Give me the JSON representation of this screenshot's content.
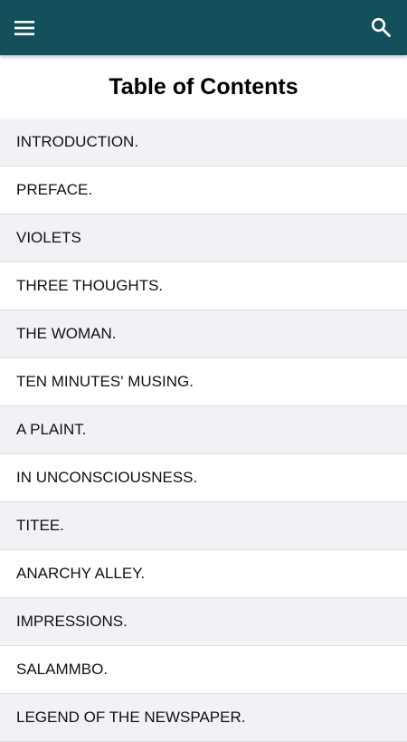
{
  "appbar": {
    "menu_icon": "hamburger-menu-icon",
    "search_icon": "search-icon",
    "background": "#13505b"
  },
  "page": {
    "title": "Table of Contents"
  },
  "toc": {
    "items": [
      "INTRODUCTION.",
      "PREFACE.",
      "VIOLETS",
      "THREE THOUGHTS.",
      "THE WOMAN.",
      "TEN MINUTES' MUSING.",
      "A PLAINT.",
      "IN UNCONSCIOUSNESS.",
      "TITEE.",
      "ANARCHY ALLEY.",
      "IMPRESSIONS.",
      "SALAMMBO.",
      "LEGEND OF THE NEWSPAPER."
    ]
  }
}
